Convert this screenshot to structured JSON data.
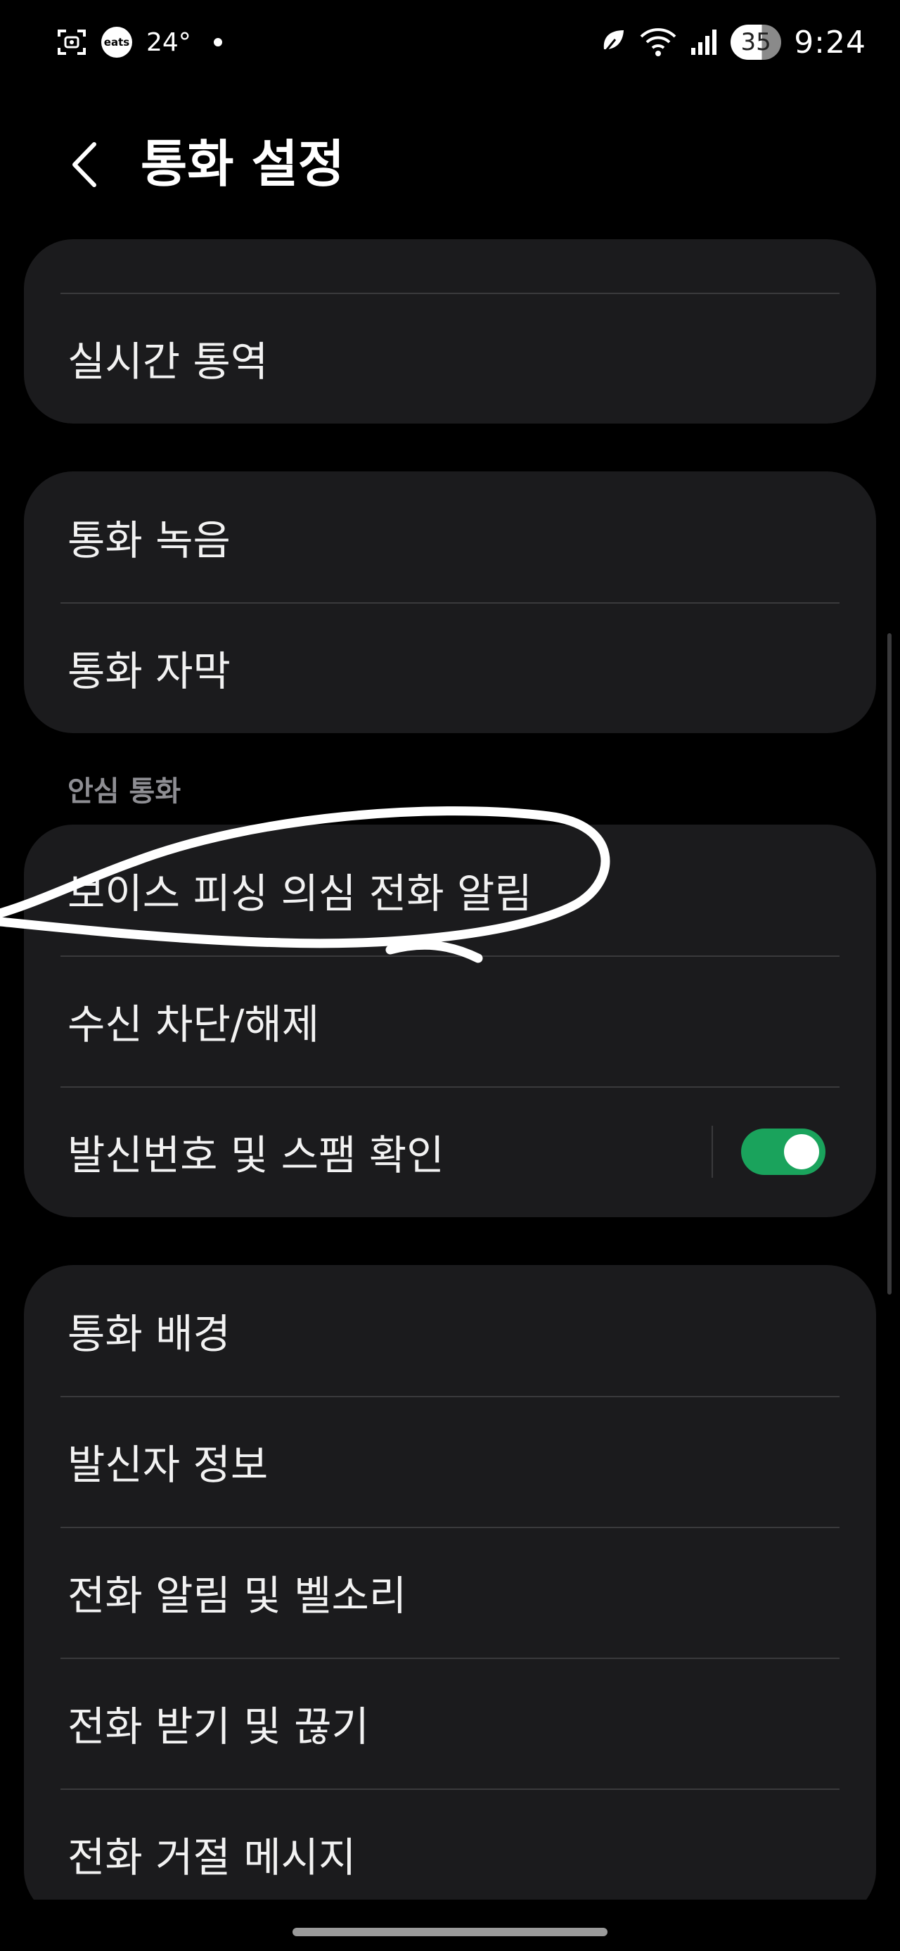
{
  "status_bar": {
    "app_badge_text": "eats",
    "temperature": "24°",
    "battery_level": "35",
    "time": "9:24"
  },
  "header": {
    "title": "통화 설정"
  },
  "groups": [
    {
      "items": [
        {
          "label": "실시간 통역"
        }
      ]
    },
    {
      "items": [
        {
          "label": "통화 녹음"
        },
        {
          "label": "통화 자막"
        }
      ]
    },
    {
      "section_title": "안심 통화",
      "items": [
        {
          "label": "보이스 피싱 의심 전화 알림"
        },
        {
          "label": "수신 차단/해제"
        },
        {
          "label": "발신번호 및 스팸 확인",
          "toggle": true
        }
      ]
    },
    {
      "items": [
        {
          "label": "통화 배경"
        },
        {
          "label": "발신자 정보"
        },
        {
          "label": "전화 알림 및 벨소리"
        },
        {
          "label": "전화 받기 및 끊기"
        },
        {
          "label": "전화 거절 메시지"
        }
      ]
    }
  ],
  "colors": {
    "background": "#000000",
    "card": "#1b1b1d",
    "toggle_on": "#1aa35c",
    "section_title": "#8e8e93"
  }
}
